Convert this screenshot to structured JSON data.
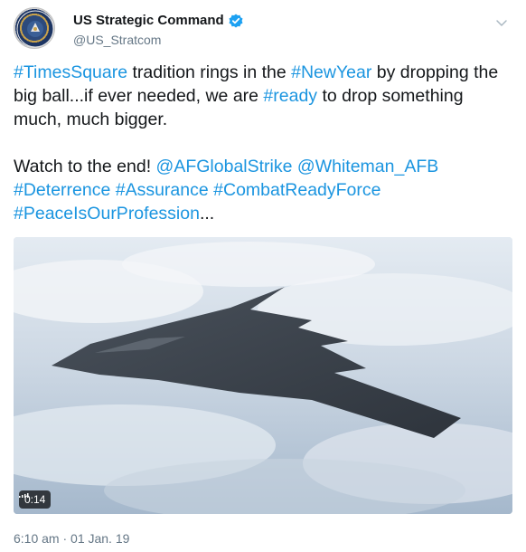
{
  "account": {
    "display_name": "US Strategic Command",
    "handle": "@US_Stratcom",
    "verified": true
  },
  "tweet": {
    "line1": [
      {
        "text": "#TimesSquare",
        "type": "hashtag"
      },
      {
        "text": " tradition rings in the ",
        "type": "text"
      },
      {
        "text": "#NewYear",
        "type": "hashtag"
      },
      {
        "text": " by dropping the big ball...if ever needed, we are ",
        "type": "text"
      },
      {
        "text": "#ready",
        "type": "hashtag"
      },
      {
        "text": " to drop something much, much bigger.",
        "type": "text"
      }
    ],
    "line2": [
      {
        "text": "Watch to the end! ",
        "type": "text"
      },
      {
        "text": "@AFGlobalStrike",
        "type": "mention"
      },
      {
        "text": "  ",
        "type": "text"
      },
      {
        "text": "@Whiteman_AFB",
        "type": "mention"
      },
      {
        "text": " ",
        "type": "text"
      },
      {
        "text": "#Deterrence",
        "type": "hashtag"
      },
      {
        "text": " ",
        "type": "text"
      },
      {
        "text": "#Assurance",
        "type": "hashtag"
      },
      {
        "text": " ",
        "type": "text"
      },
      {
        "text": "#CombatReadyForce",
        "type": "hashtag"
      },
      {
        "text": " ",
        "type": "text"
      },
      {
        "text": "#PeaceIsOurProfession",
        "type": "hashtag"
      },
      {
        "text": "...",
        "type": "text"
      }
    ]
  },
  "media": {
    "type": "video",
    "duration": "0:14",
    "icon": "volume-icon"
  },
  "footer": {
    "timestamp": "6:10 am · 01 Jan. 19"
  },
  "icons": {
    "verified": "verified-badge-icon",
    "menu": "chevron-down-icon"
  },
  "colors": {
    "link": "#1b95e0",
    "verified": "#1da1f2",
    "secondary_text": "#657786"
  }
}
